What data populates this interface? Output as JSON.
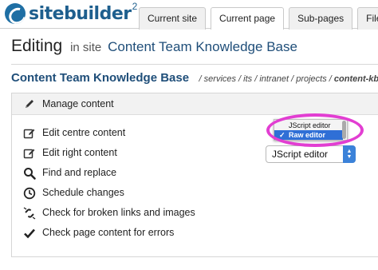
{
  "header": {
    "logo_text": "sitebuilder",
    "logo_sup": "2",
    "tabs": [
      {
        "label": "Current site",
        "active": false
      },
      {
        "label": "Current page",
        "active": true
      },
      {
        "label": "Sub-pages",
        "active": false
      },
      {
        "label": "Files",
        "active": false
      }
    ]
  },
  "page": {
    "title_prefix": "Editing",
    "title_in_site": "in site",
    "site_name": "Content Team Knowledge Base"
  },
  "breadcrumb": {
    "title": "Content Team Knowledge Base",
    "path": "/ services / its / intranet / projects /",
    "current": "content-kb"
  },
  "panel": {
    "header_label": "Manage content",
    "items": [
      {
        "label": "Edit centre content",
        "icon": "edit-icon"
      },
      {
        "label": "Edit right content",
        "icon": "edit-icon"
      },
      {
        "label": "Find and replace",
        "icon": "search-icon"
      },
      {
        "label": "Schedule changes",
        "icon": "clock-icon"
      },
      {
        "label": "Check for broken links and images",
        "icon": "broken-link-icon"
      },
      {
        "label": "Check page content for errors",
        "icon": "checkmark-icon"
      }
    ]
  },
  "editor_select": {
    "value": "JScript editor",
    "options": [
      {
        "label": "JScript editor",
        "selected": false
      },
      {
        "label": "Raw editor",
        "selected": true
      }
    ]
  },
  "colors": {
    "accent": "#1f4e79",
    "highlight": "#e23ed2",
    "selected_option": "#2f6fd6"
  }
}
